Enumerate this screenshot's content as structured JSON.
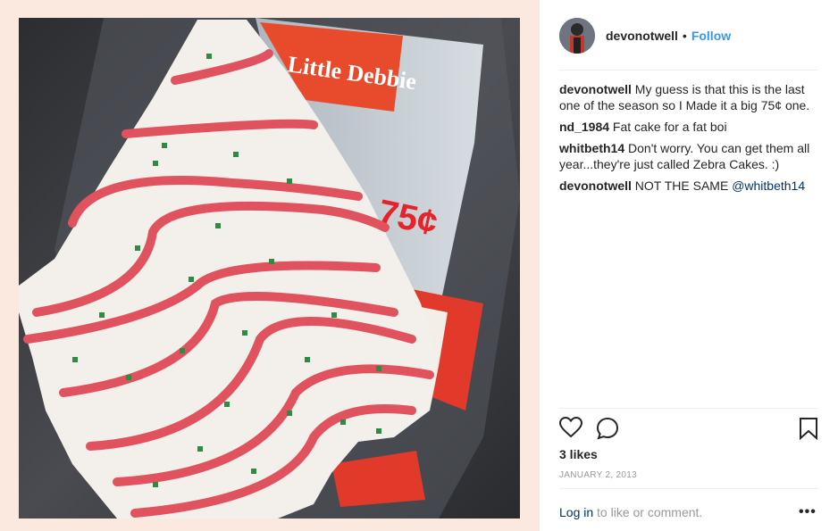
{
  "post": {
    "photo_description_icon": "photo-icon",
    "package_brand": "Little Debbie",
    "package_price": "75¢",
    "username": "devonotwell",
    "separator": "•",
    "follow_label": "Follow"
  },
  "comments": [
    {
      "user": "devonotwell",
      "text": " My guess is that this is the last one of the season so I Made it a big 75¢ one."
    },
    {
      "user": "nd_1984",
      "text": " Fat cake for a fat boi"
    },
    {
      "user": "whitbeth14",
      "text": " Don't worry. You can get them all year...they're just called Zebra Cakes. :)"
    },
    {
      "user": "devonotwell",
      "text": " NOT THE SAME ",
      "mention": "@whitbeth14"
    }
  ],
  "actions": {
    "like_icon": "heart-icon",
    "comment_icon": "comment-bubble-icon",
    "save_icon": "bookmark-icon"
  },
  "likes_text": "3 likes",
  "date_text": "January 2, 2013",
  "login": {
    "link_label": "Log in",
    "suffix": " to like or comment.",
    "more_label": "•••"
  },
  "colors": {
    "follow": "#3897f0",
    "link": "#003569",
    "muted": "#999999",
    "panel_bg": "#fbe9e0"
  }
}
